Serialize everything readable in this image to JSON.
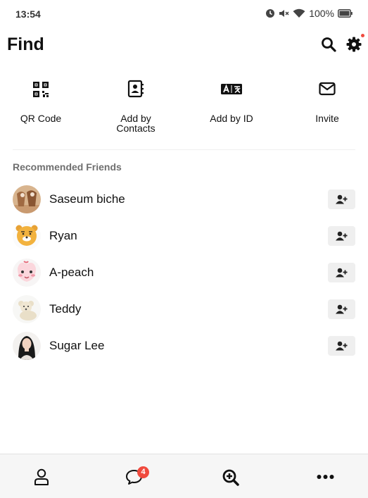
{
  "status_bar": {
    "time": "13:54",
    "battery": "100%",
    "icons": [
      "alarm-icon",
      "mute-icon",
      "wifi-icon",
      "battery-icon"
    ]
  },
  "header": {
    "title": "Find",
    "actions": [
      "search-icon",
      "gear-icon"
    ],
    "settings_dot_color": "#f04a3e"
  },
  "shortcuts": [
    {
      "label": "QR Code",
      "icon": "qr-code-icon"
    },
    {
      "label": "Add by\nContacts",
      "icon": "contacts-book-icon"
    },
    {
      "label": "Add by ID",
      "icon": "id-translate-icon"
    },
    {
      "label": "Invite",
      "icon": "envelope-icon"
    }
  ],
  "recommended": {
    "title": "Recommended Friends",
    "friends": [
      {
        "name": "Saseum biche",
        "avatar": "deer-photo"
      },
      {
        "name": "Ryan",
        "avatar": "lion-character"
      },
      {
        "name": "A-peach",
        "avatar": "peach-character"
      },
      {
        "name": "Teddy",
        "avatar": "teddy-bear-photo"
      },
      {
        "name": "Sugar Lee",
        "avatar": "portrait-photo"
      }
    ],
    "add_icon": "add-friend-icon"
  },
  "bottom_nav": {
    "items": [
      "friends-icon",
      "chats-icon",
      "find-icon",
      "more-icon"
    ],
    "chat_badge": "4",
    "badge_color": "#f04a3e"
  }
}
